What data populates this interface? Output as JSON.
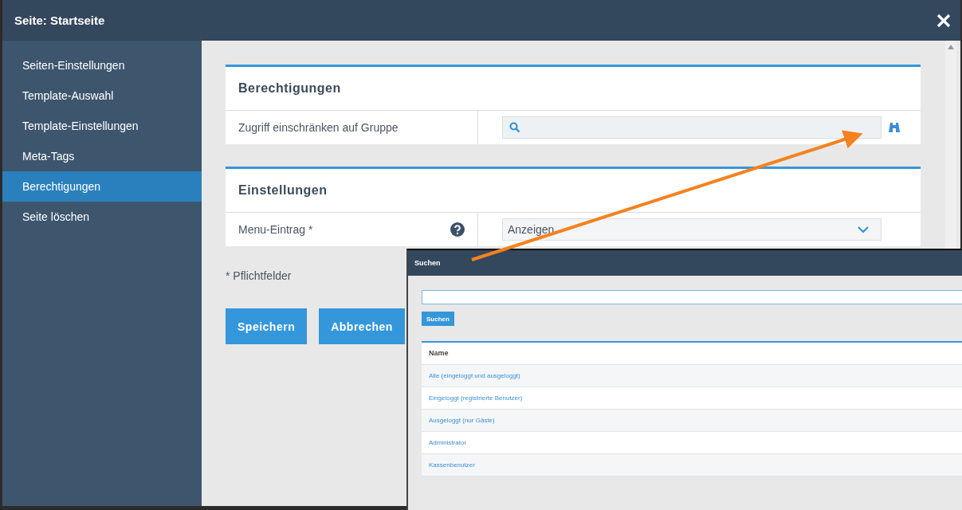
{
  "window": {
    "title": "Seite: Startseite"
  },
  "sidebar": {
    "items": [
      {
        "label": "Seiten-Einstellungen",
        "selected": false
      },
      {
        "label": "Template-Auswahl",
        "selected": false
      },
      {
        "label": "Template-Einstellungen",
        "selected": false
      },
      {
        "label": "Meta-Tags",
        "selected": false
      },
      {
        "label": "Berechtigungen",
        "selected": true
      },
      {
        "label": "Seite löschen",
        "selected": false
      }
    ]
  },
  "sections": [
    {
      "title": "Berechtigungen",
      "rows": [
        {
          "kind": "search",
          "label": "Zugriff einschränken auf Gruppe",
          "help": false
        }
      ]
    },
    {
      "title": "Einstellungen",
      "rows": [
        {
          "kind": "select",
          "label": "Menu-Eintrag *",
          "value": "Anzeigen",
          "help": true
        }
      ]
    }
  ],
  "footnote": "* Pflichtfelder",
  "buttons": [
    "Speichern",
    "Abbrechen"
  ],
  "search_dialog": {
    "title": "Suchen",
    "button": "Suchen",
    "table": {
      "columns": [
        "Name"
      ],
      "rows": [
        "Alle (eingeloggt und ausgeloggt)",
        "Eingeloggt (registrierte Benutzer)",
        "Ausgeloggt (nur Gäste)",
        "Administrator",
        "Kassenbenutzer"
      ]
    }
  }
}
